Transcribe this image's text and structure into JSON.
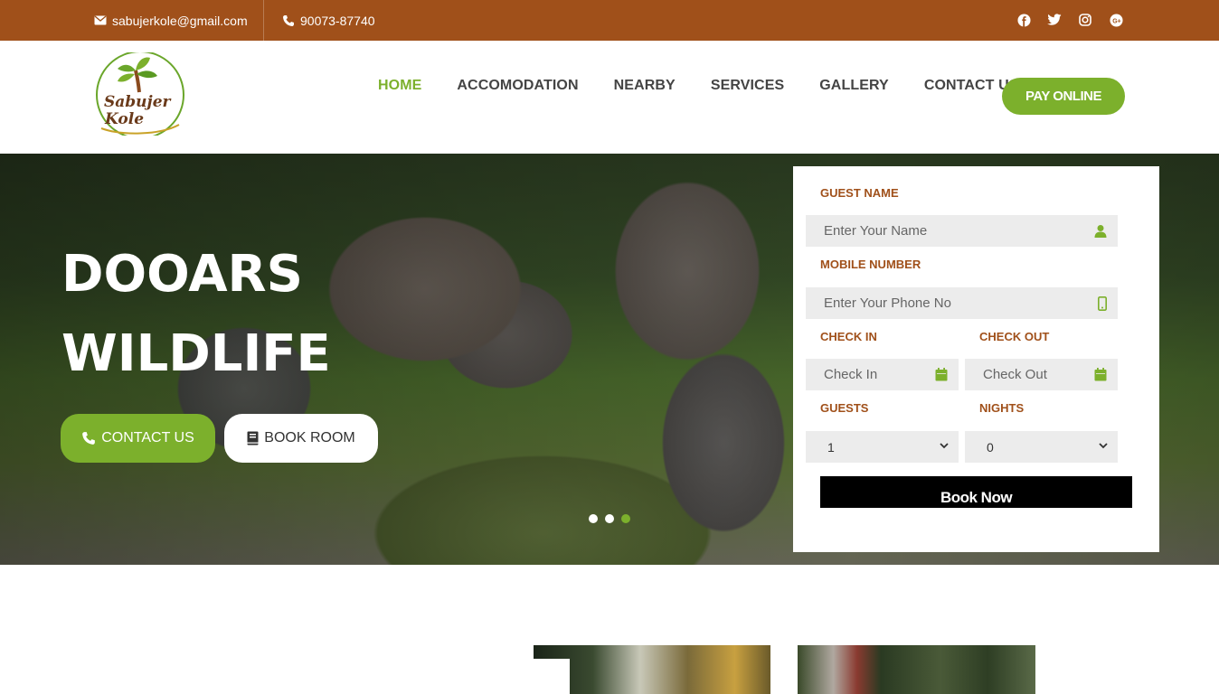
{
  "topbar": {
    "email": "sabujerkole@gmail.com",
    "phone": "90073-87740",
    "socials": [
      "facebook-icon",
      "twitter-icon",
      "instagram-icon",
      "google-plus-icon"
    ]
  },
  "brand": {
    "logo_line1": "Sabujer",
    "logo_line2": "Kole"
  },
  "nav": {
    "items": [
      "HOME",
      "ACCOMODATION",
      "NEARBY",
      "SERVICES",
      "GALLERY",
      "CONTACT US"
    ],
    "active": "HOME",
    "pay_label": "PAY ONLINE"
  },
  "hero": {
    "title_line1": "DOOARS",
    "title_line2": "WILDLIFE",
    "contact_label": "CONTACT US",
    "book_label": "BOOK ROOM",
    "slides": 3,
    "active_slide": 3
  },
  "booking": {
    "guest_name_label": "GUEST NAME",
    "guest_name_placeholder": "Enter Your Name",
    "mobile_label": "MOBILE NUMBER",
    "mobile_placeholder": "Enter Your Phone No",
    "checkin_label": "CHECK IN",
    "checkin_placeholder": "Check In",
    "checkout_label": "CHECK OUT",
    "checkout_placeholder": "Check Out",
    "guests_label": "GUESTS",
    "guests_value": "1",
    "nights_label": "NIGHTS",
    "nights_value": "0",
    "submit_label": "Book Now"
  },
  "colors": {
    "topbar": "#a0501a",
    "accent_green": "#7cb02c",
    "label_brown": "#a0501a"
  }
}
